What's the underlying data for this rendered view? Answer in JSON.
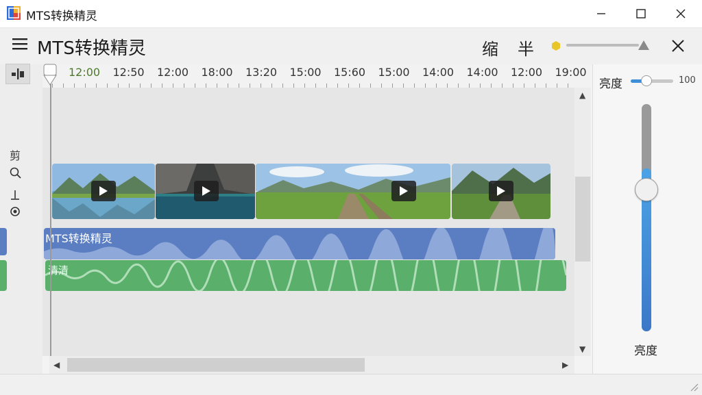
{
  "window": {
    "title": "MTS转换精灵",
    "controls": [
      "minimize-icon",
      "maximize-icon",
      "close-icon"
    ]
  },
  "header": {
    "app_title": "MTS转换精灵",
    "btn1_label": "缩",
    "btn2_label": "半",
    "zoom_slider_value": 0.9,
    "accent_color": "#e8c62a"
  },
  "toolbar": {
    "snap_icon": "snap-icon",
    "side_tools": [
      "剪",
      "🔍",
      "⊥",
      "⊙"
    ]
  },
  "timeline": {
    "ticks": [
      "12:00",
      "12:50",
      "12:00",
      "18:00",
      "13:20",
      "15:00",
      "15:60",
      "15:00",
      "14:00",
      "14:00",
      "12:00",
      "19:00"
    ],
    "first_tick_color": "#4c7a2b",
    "video_clips": [
      {
        "name": "lake-mountains"
      },
      {
        "name": "rocky-water"
      },
      {
        "name": "grass-valley"
      },
      {
        "name": "mountain-path"
      }
    ],
    "title_track_label": "MTS转换精灵",
    "audio_track_label": "清清",
    "title_track_color": "#5b7ec2",
    "audio_track_color": "#5aaf6b"
  },
  "brightness_panel": {
    "label_top": "亮度",
    "value": "100",
    "label_bottom": "亮度",
    "level": 0.6
  }
}
